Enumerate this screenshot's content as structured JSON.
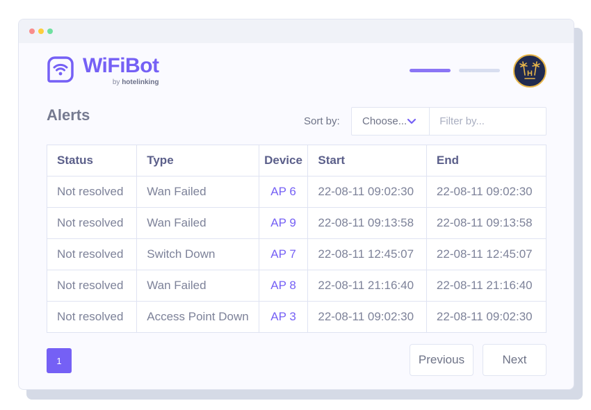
{
  "window": {
    "traffic_lights": [
      "close",
      "minimize",
      "maximize"
    ]
  },
  "brand": {
    "name": "WiFiBot",
    "by_prefix": "by",
    "by_name": "hotelinking",
    "icon": "wifi-icon",
    "color": "#7560f5"
  },
  "progress": {
    "steps_total": 2,
    "steps_active": 1
  },
  "avatar": {
    "icon": "palm-trees-hotel-logo",
    "letter": "H"
  },
  "page": {
    "title": "Alerts"
  },
  "controls": {
    "sort_label": "Sort by:",
    "sort_value": "Choose...",
    "sort_icon": "chevron-down-icon",
    "filter_placeholder": "Filter by..."
  },
  "table": {
    "columns": [
      "Status",
      "Type",
      "Device",
      "Start",
      "End"
    ],
    "rows": [
      {
        "status": "Not resolved",
        "type": "Wan Failed",
        "device": "AP 6",
        "start": "22-08-11 09:02:30",
        "end": "22-08-11 09:02:30"
      },
      {
        "status": "Not resolved",
        "type": "Wan Failed",
        "device": "AP 9",
        "start": "22-08-11 09:13:58",
        "end": "22-08-11 09:13:58"
      },
      {
        "status": "Not resolved",
        "type": "Switch Down",
        "device": "AP 7",
        "start": "22-08-11 12:45:07",
        "end": "22-08-11 12:45:07"
      },
      {
        "status": "Not resolved",
        "type": "Wan Failed",
        "device": "AP 8",
        "start": "22-08-11 21:16:40",
        "end": "22-08-11 21:16:40"
      },
      {
        "status": "Not resolved",
        "type": "Access Point Down",
        "device": "AP 3",
        "start": "22-08-11 09:02:30",
        "end": "22-08-11 09:02:30"
      }
    ]
  },
  "pagination": {
    "current_page": "1",
    "previous_label": "Previous",
    "next_label": "Next"
  }
}
